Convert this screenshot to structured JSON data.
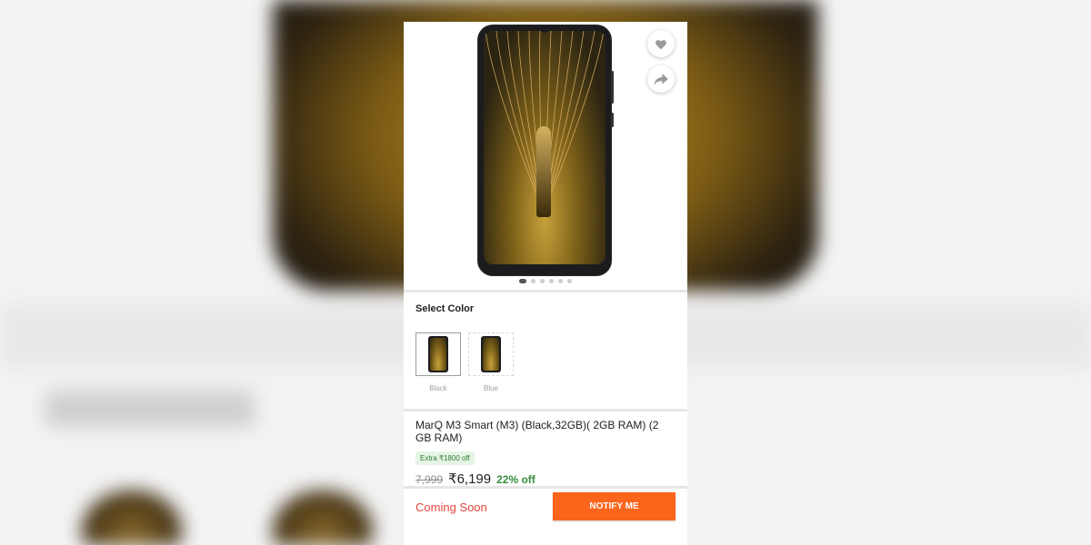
{
  "product": {
    "title": "MarQ M3 Smart (M3) (Black,32GB)( 2GB RAM) (2 GB RAM)",
    "image_count": 6,
    "active_image": 1
  },
  "colors": {
    "section_label": "Select Color",
    "options": [
      {
        "label": "Black",
        "selected": true
      },
      {
        "label": "Blue",
        "selected": false
      }
    ]
  },
  "offer": {
    "badge": "Extra ₹1800 off"
  },
  "pricing": {
    "mrp": "7,999",
    "price": "₹6,199",
    "discount": "22% off"
  },
  "actions": {
    "availability": "Coming Soon",
    "notify_label": "NOTIFY ME",
    "wishlist_icon": "heart-icon",
    "share_icon": "share-icon"
  },
  "theme": {
    "accent": "#fb641b",
    "discount_green": "#388e3c",
    "coming_soon_red": "#e0463b"
  }
}
